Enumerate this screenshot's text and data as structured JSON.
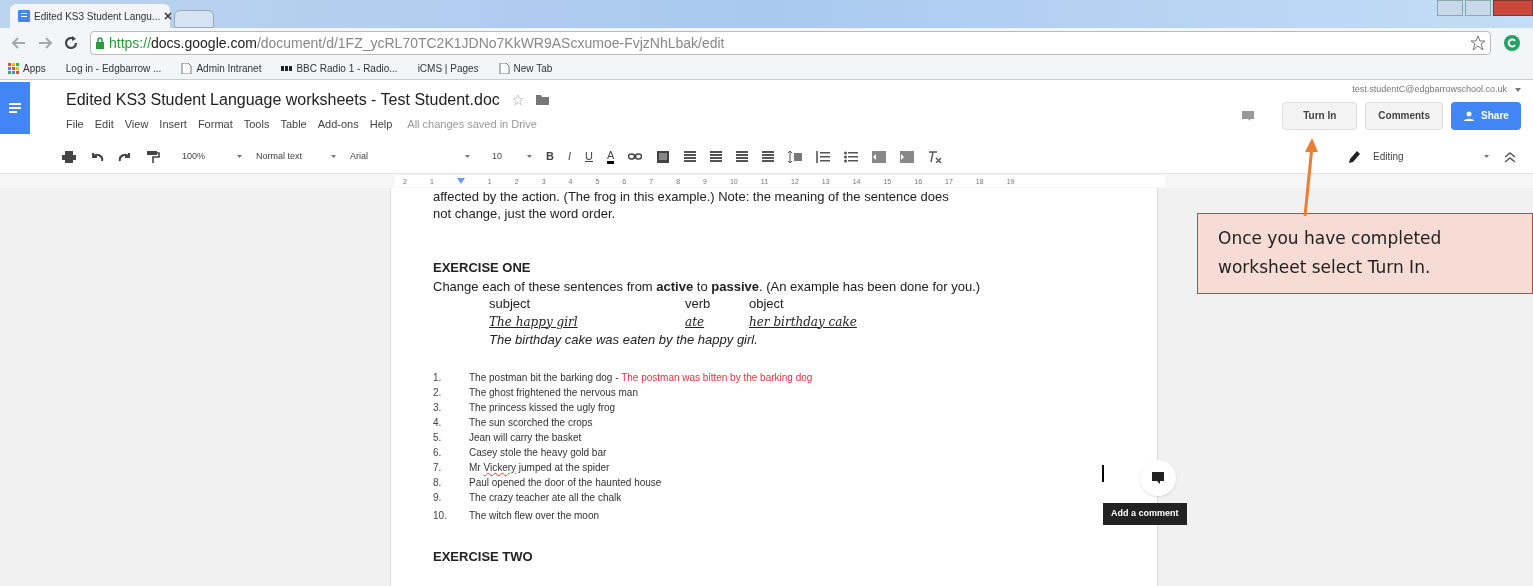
{
  "browser": {
    "tabs": [
      {
        "title": "Edited KS3 Student Langu...",
        "selected": true
      }
    ],
    "url": {
      "scheme": "https://",
      "host": "docs.google.com",
      "path": "/document/d/1FZ_ycRL70TC2K1JDNo7KkWR9AScxumoe-FvjzNhLbak/edit"
    },
    "bookmarks": [
      {
        "label": "Apps",
        "kind": "apps"
      },
      {
        "label": "Log in - Edgbarrow ...",
        "kind": "site"
      },
      {
        "label": "Admin Intranet",
        "kind": "page"
      },
      {
        "label": "BBC Radio 1 - Radio...",
        "kind": "bbc"
      },
      {
        "label": "iCMS | Pages",
        "kind": "site"
      },
      {
        "label": "New Tab",
        "kind": "page"
      }
    ]
  },
  "docs": {
    "title": "Edited KS3 Student Language worksheets - Test Student.doc",
    "menu": [
      "File",
      "Edit",
      "View",
      "Insert",
      "Format",
      "Tools",
      "Table",
      "Add-ons",
      "Help"
    ],
    "save_status": "All changes saved in Drive",
    "account": "test.studentC@edgbarrowschool.co.uk",
    "buttons": {
      "turn_in": "Turn In",
      "comments": "Comments",
      "share": "Share"
    }
  },
  "toolbar": {
    "zoom": "100%",
    "style": "Normal text",
    "font": "Arial",
    "size": "10",
    "bold": "B",
    "italic": "I",
    "underline": "U",
    "text_color": "A",
    "mode": "Editing"
  },
  "ruler": [
    "2",
    "1",
    "1",
    "2",
    "3",
    "4",
    "5",
    "6",
    "7",
    "8",
    "9",
    "10",
    "11",
    "12",
    "13",
    "14",
    "15",
    "16",
    "17",
    "18",
    "19"
  ],
  "document": {
    "intro": [
      "affected by the action. (The frog in this example.) Note: the meaning of the sentence does",
      "not change, just the word order."
    ],
    "exercise_one": {
      "heading": "EXERCISE ONE",
      "instruction": "Change each of these sentences from **active** to **passive**. (An example has been done for you.)",
      "columns": [
        "subject",
        "verb",
        "object"
      ],
      "example": [
        "The happy girl",
        "ate",
        "her birthday cake"
      ],
      "example_answer": "The birthday cake was eaten by the happy girl.",
      "items": [
        {
          "number": "1.",
          "text": "The postman bit the barking dog - ",
          "answer": "The postman was bitten by the barking dog"
        },
        {
          "number": "2.",
          "text": "The ghost frightened the nervous man"
        },
        {
          "number": "3.",
          "text": "The princess kissed the ugly frog"
        },
        {
          "number": "4.",
          "text": "The sun scorched the crops"
        },
        {
          "number": "5.",
          "text": "Jean will carry the basket"
        },
        {
          "number": "6.",
          "text": "Casey stole the heavy gold bar"
        },
        {
          "number": "7.",
          "segments": [
            {
              "text": "Mr ",
              "misspelled": false
            },
            {
              "text": "Vickery",
              "misspelled": true
            },
            {
              "text": " jumped at the spider",
              "misspelled": false
            }
          ]
        },
        {
          "number": "8.",
          "text": "Paul opened the door of the haunted house"
        },
        {
          "number": "9.",
          "text": "The crazy teacher ate all the chalk"
        },
        {
          "number": "10.",
          "text": "The witch flew over the moon"
        }
      ]
    },
    "exercise_two": {
      "heading": "EXERCISE TWO"
    }
  },
  "comment_tooltip": "Add a comment",
  "callout": "Once you have completed worksheet select Turn In."
}
